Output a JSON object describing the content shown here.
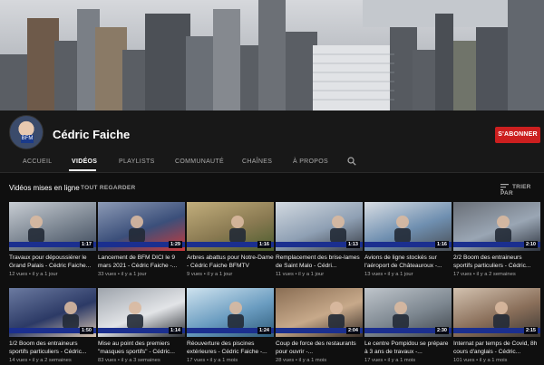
{
  "channel": {
    "name": "Cédric Faiche",
    "subscribe_label": "S'ABONNER"
  },
  "tabs": [
    {
      "label": "ACCUEIL",
      "active": false
    },
    {
      "label": "VIDÉOS",
      "active": true
    },
    {
      "label": "PLAYLISTS",
      "active": false
    },
    {
      "label": "COMMUNAUTÉ",
      "active": false
    },
    {
      "label": "CHAÎNES",
      "active": false
    },
    {
      "label": "À PROPOS",
      "active": false
    }
  ],
  "section": {
    "title": "Vidéos mises en ligne",
    "see_all": "TOUT REGARDER",
    "sort_label": "TRIER PAR"
  },
  "videos": [
    {
      "title": "Travaux pour dépoussiérer le Grand Palais - Cédric Faiche...",
      "meta": "12 vues • il y a 1 jour",
      "duration": "1:17"
    },
    {
      "title": "Lancement de BFM DICI le 9 mars 2021 - Cédric Faiche -...",
      "meta": "33 vues • il y a 1 jour",
      "duration": "1:29"
    },
    {
      "title": "Arbres abattus pour Notre-Dame - Cédric Faiche BFMTV",
      "meta": "9 vues • il y a 1 jour",
      "duration": "1:16"
    },
    {
      "title": "Remplacement des brise-lames de Saint Malo - Cédri...",
      "meta": "11 vues • il y a 1 jour",
      "duration": "1:13"
    },
    {
      "title": "Avions de ligne stockés sur l'aéroport de Châteauroux -...",
      "meta": "13 vues • il y a 1 jour",
      "duration": "1:16"
    },
    {
      "title": "2/2 Boom des entraineurs sportifs particuliers - Cédric...",
      "meta": "17 vues • il y a 2 semaines",
      "duration": "2:10"
    },
    {
      "title": "1/2 Boom des entraineurs sportifs particuliers - Cédric...",
      "meta": "14 vues • il y a 2 semaines",
      "duration": "1:50"
    },
    {
      "title": "Mise au point des premiers \"masques sportifs\" - Cédric...",
      "meta": "83 vues • il y a 3 semaines",
      "duration": "1:14"
    },
    {
      "title": "Réouverture des piscines extérieures - Cédric Faiche -...",
      "meta": "17 vues • il y a 1 mois",
      "duration": "1:24"
    },
    {
      "title": "Coup de force des restaurants pour ouvrir -...",
      "meta": "28 vues • il y a 1 mois",
      "duration": "2:04"
    },
    {
      "title": "Le centre Pompidou se prépare à 3 ans de travaux -...",
      "meta": "17 vues • il y a 1 mois",
      "duration": "2:30"
    },
    {
      "title": "Internat par temps de Covid, 8h cours d'anglais - Cédric...",
      "meta": "101 vues • il y a 1 mois",
      "duration": "2:15"
    }
  ]
}
